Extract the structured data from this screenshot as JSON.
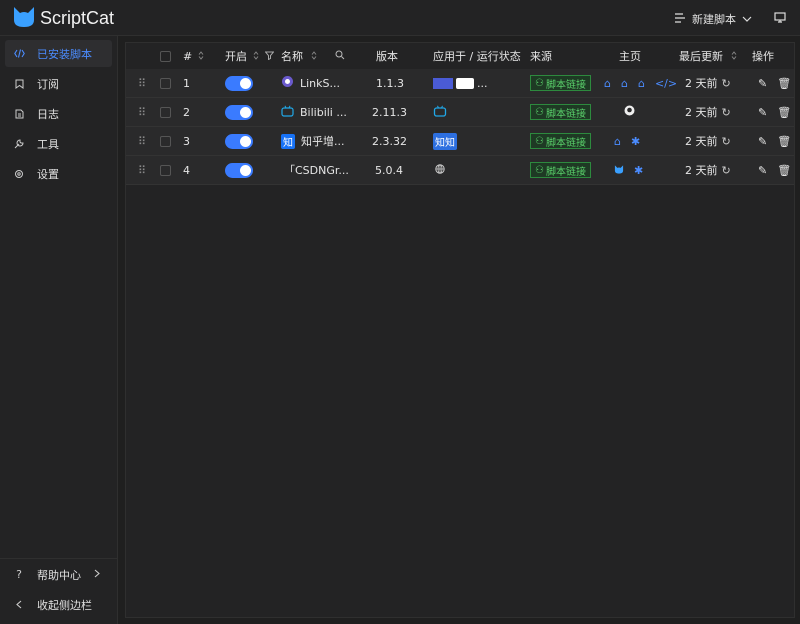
{
  "app": {
    "title": "ScriptCat"
  },
  "header": {
    "new_script_label": "新建脚本"
  },
  "sidebar": {
    "items": [
      {
        "label": "已安装脚本",
        "icon": "code-icon",
        "active": true
      },
      {
        "label": "订阅",
        "icon": "bookmark-icon",
        "active": false
      },
      {
        "label": "日志",
        "icon": "file-icon",
        "active": false
      },
      {
        "label": "工具",
        "icon": "tool-icon",
        "active": false
      },
      {
        "label": "设置",
        "icon": "settings-icon",
        "active": false
      }
    ],
    "help_label": "帮助中心",
    "collapse_label": "收起侧边栏"
  },
  "table": {
    "columns": {
      "number": "#",
      "enable": "开启",
      "name": "名称",
      "version": "版本",
      "applies": "应用于 / 运行状态",
      "source": "来源",
      "homepage": "主页",
      "updated": "最后更新",
      "actions": "操作"
    },
    "rows": [
      {
        "num": "1",
        "name": "LinkS...",
        "version": "1.1.3",
        "source": "脚本链接",
        "updated": "2 天前",
        "enabled": true,
        "applies_badge": "",
        "applies_extra": "..."
      },
      {
        "num": "2",
        "name": "Bilibili ...",
        "version": "2.11.3",
        "source": "脚本链接",
        "updated": "2 天前",
        "enabled": true,
        "applies_badge": "",
        "applies_extra": ""
      },
      {
        "num": "3",
        "name": "知乎增...",
        "version": "2.3.32",
        "source": "脚本链接",
        "updated": "2 天前",
        "enabled": true,
        "applies_badge": "知知",
        "applies_extra": ""
      },
      {
        "num": "4",
        "name": "「CSDNGr...",
        "version": "5.0.4",
        "source": "脚本链接",
        "updated": "2 天前",
        "enabled": true,
        "applies_badge": "",
        "applies_extra": ""
      }
    ]
  },
  "colors": {
    "accent": "#3a7bff",
    "source_green": "#5ad06b",
    "link_blue": "#4b8cff"
  }
}
